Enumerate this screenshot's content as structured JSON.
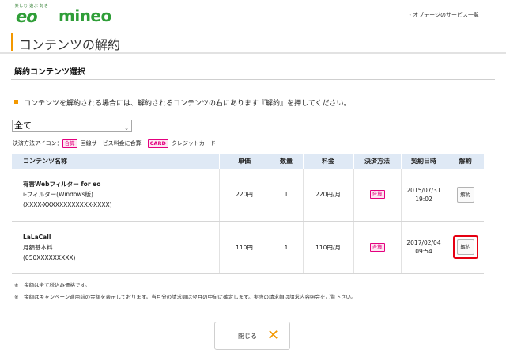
{
  "header": {
    "eo_tagline": "楽しむ 遊ぶ 好き",
    "eo_logo": "eo",
    "mineo_logo": "mineo",
    "top_link": "・オプテージのサービス一覧"
  },
  "page_title": "コンテンツの解約",
  "section_title": "解約コンテンツ選択",
  "instruction": "コンテンツを解約される場合には、解約されるコンテンツの右にあります『解約』を押してください。",
  "filter": {
    "selected": "全て",
    "arrow": "⌄"
  },
  "payment_legend": {
    "label": "決済方法アイコン：",
    "gassan_badge": "合算",
    "gassan_text": "回線サービス料金に合算",
    "card_badge": "CARD",
    "card_text": "クレジットカード"
  },
  "table": {
    "headers": [
      "コンテンツ名称",
      "単価",
      "数量",
      "料金",
      "決済方法",
      "契約日時",
      "解約"
    ],
    "rows": [
      {
        "name": "有害Webフィルター for eo",
        "plan": "i-フィルター(Windows版)",
        "id": "(XXXX-XXXXXXXXXXXX-XXXX)",
        "unit_price": "220円",
        "quantity": "1",
        "fee": "220円/月",
        "payment": "合算",
        "date": "2015/07/31",
        "time": "19:02",
        "cancel": "解約"
      },
      {
        "name": "LaLaCall",
        "plan": "月額基本料",
        "id": "(050XXXXXXXXX)",
        "unit_price": "110円",
        "quantity": "1",
        "fee": "110円/月",
        "payment": "合算",
        "date": "2017/02/04",
        "time": "09:54",
        "cancel": "解約"
      }
    ]
  },
  "notes": [
    {
      "mark": "※",
      "text": "金額は全て税込み価格です。"
    },
    {
      "mark": "※",
      "text": "金額はキャンペーン適用前の金額を表示しております。当月分の請求額は翌月の中旬に確定します。実際の請求額は請求内容照会をご覧下さい。"
    }
  ],
  "close_button": {
    "label": "閉じる",
    "icon": "✕"
  },
  "colors": {
    "brand_green": "#2f9e38",
    "accent_orange": "#f39800",
    "badge_pink": "#e4007f",
    "highlight_red": "#e60012",
    "table_header_bg": "#dfe9f5"
  },
  "icons": {
    "close": "close-icon",
    "dropdown": "chevron-down-icon"
  }
}
